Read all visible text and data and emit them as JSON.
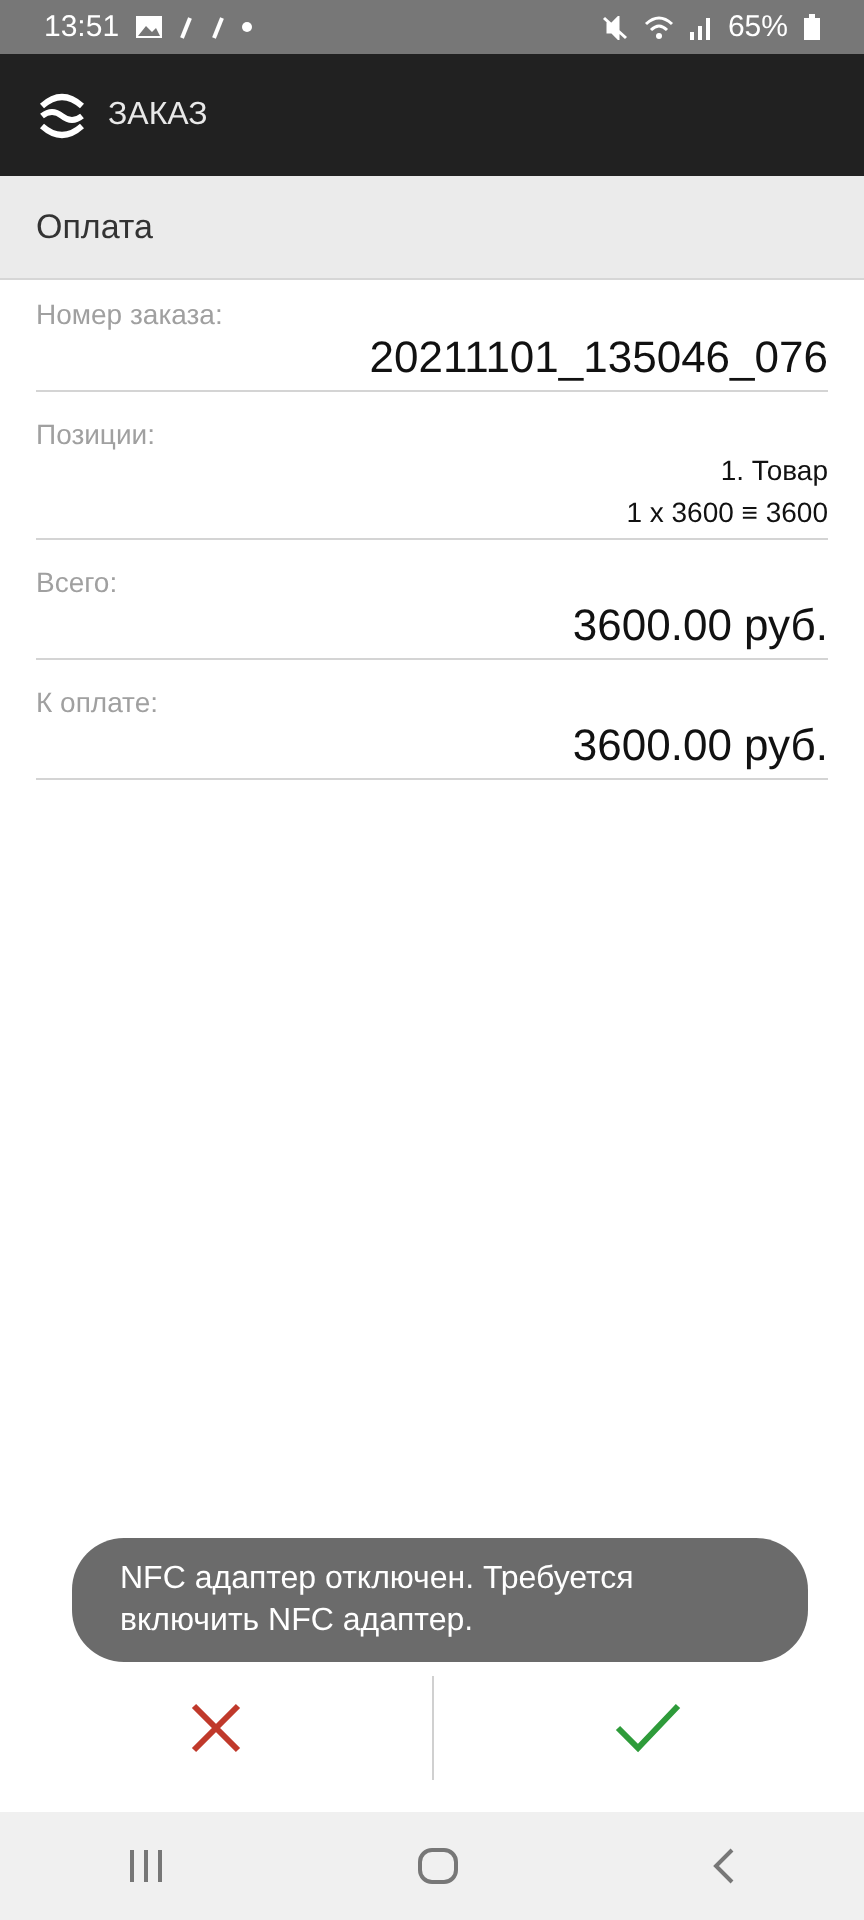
{
  "status_bar": {
    "time": "13:51",
    "battery": "65%"
  },
  "app_bar": {
    "title": "ЗАКАЗ"
  },
  "section": {
    "title": "Оплата"
  },
  "fields": [
    {
      "label": "Номер заказа:",
      "kind": "large",
      "lines": [
        "20211101_135046_076"
      ]
    },
    {
      "label": "Позиции:",
      "kind": "small",
      "lines": [
        "1. Товар",
        "1 x 3600 ≡ 3600"
      ]
    },
    {
      "label": "Всего:",
      "kind": "large",
      "lines": [
        "3600.00 руб."
      ]
    },
    {
      "label": "К оплате:",
      "kind": "large",
      "lines": [
        "3600.00 руб."
      ]
    }
  ],
  "toast": {
    "message": "NFC адаптер отключен. Требуется включить NFC адаптер."
  }
}
